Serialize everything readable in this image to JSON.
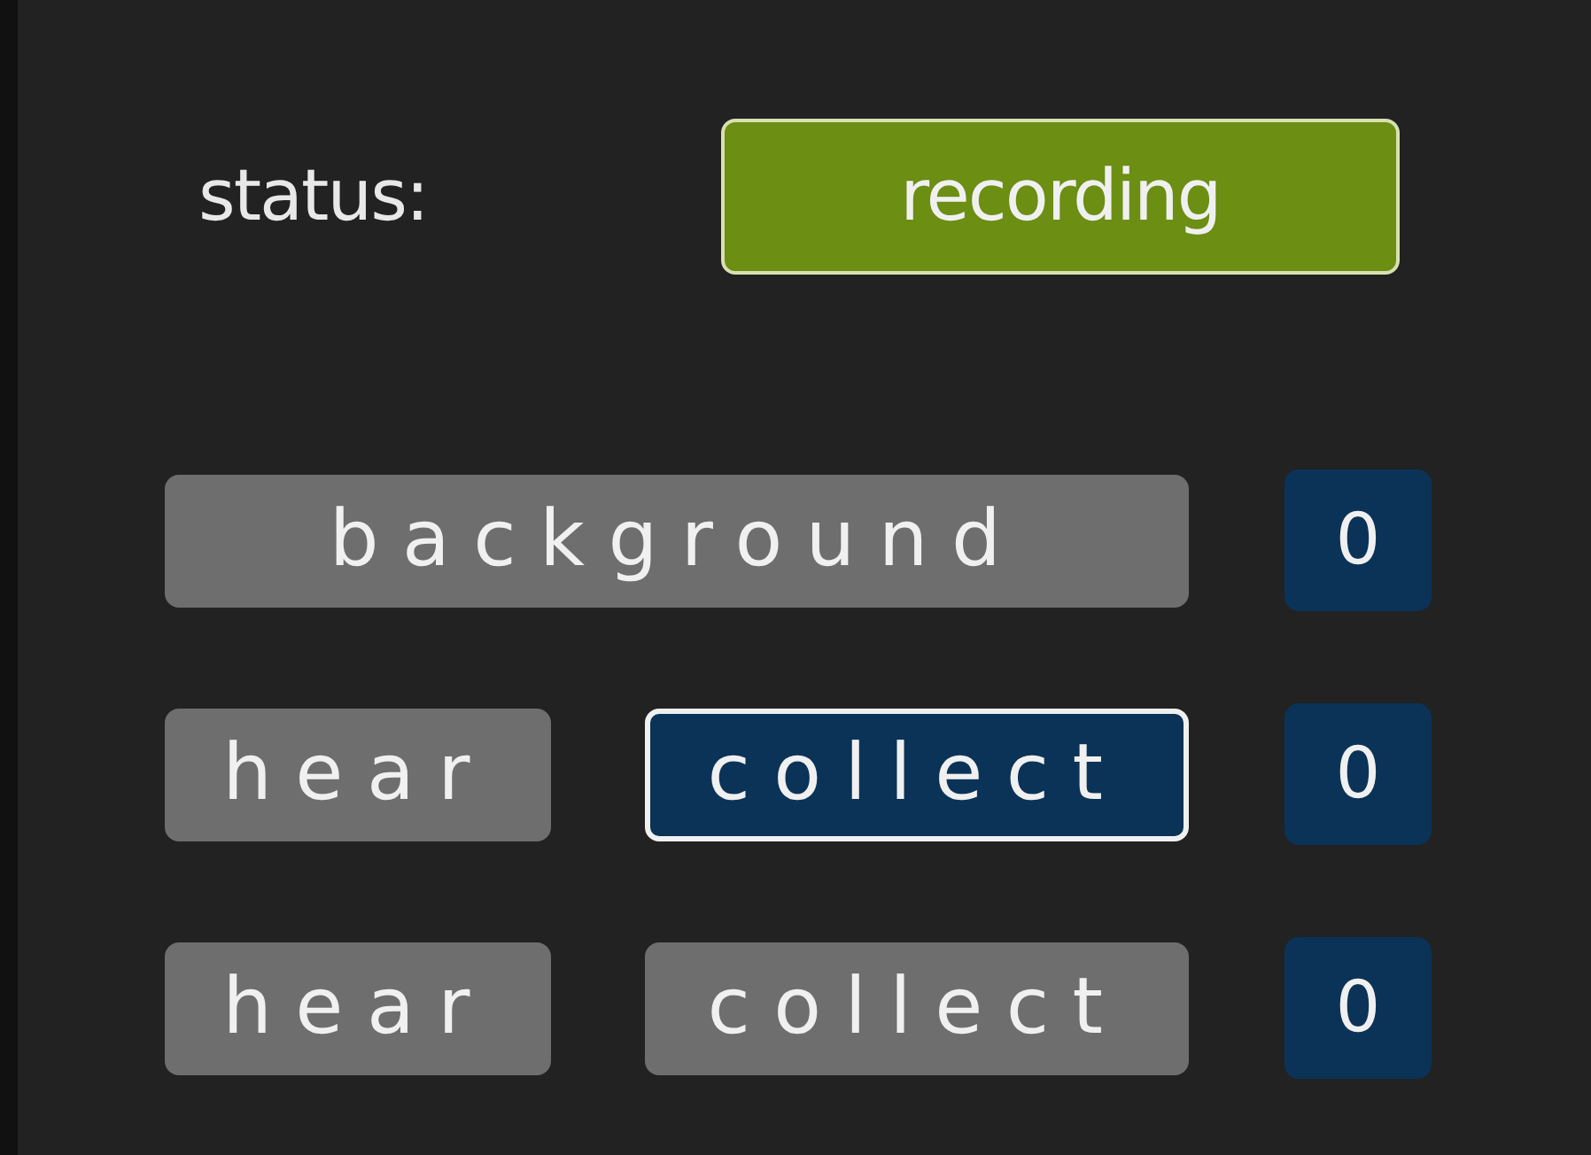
{
  "status": {
    "label": "status:",
    "value": "recording"
  },
  "rows": [
    {
      "buttons": [
        {
          "label": "background",
          "selected": false
        }
      ],
      "count": "0"
    },
    {
      "buttons": [
        {
          "label": "hear",
          "selected": false
        },
        {
          "label": "collect",
          "selected": true
        }
      ],
      "count": "0"
    },
    {
      "buttons": [
        {
          "label": "hear",
          "selected": false
        },
        {
          "label": "collect",
          "selected": false
        }
      ],
      "count": "0"
    }
  ]
}
